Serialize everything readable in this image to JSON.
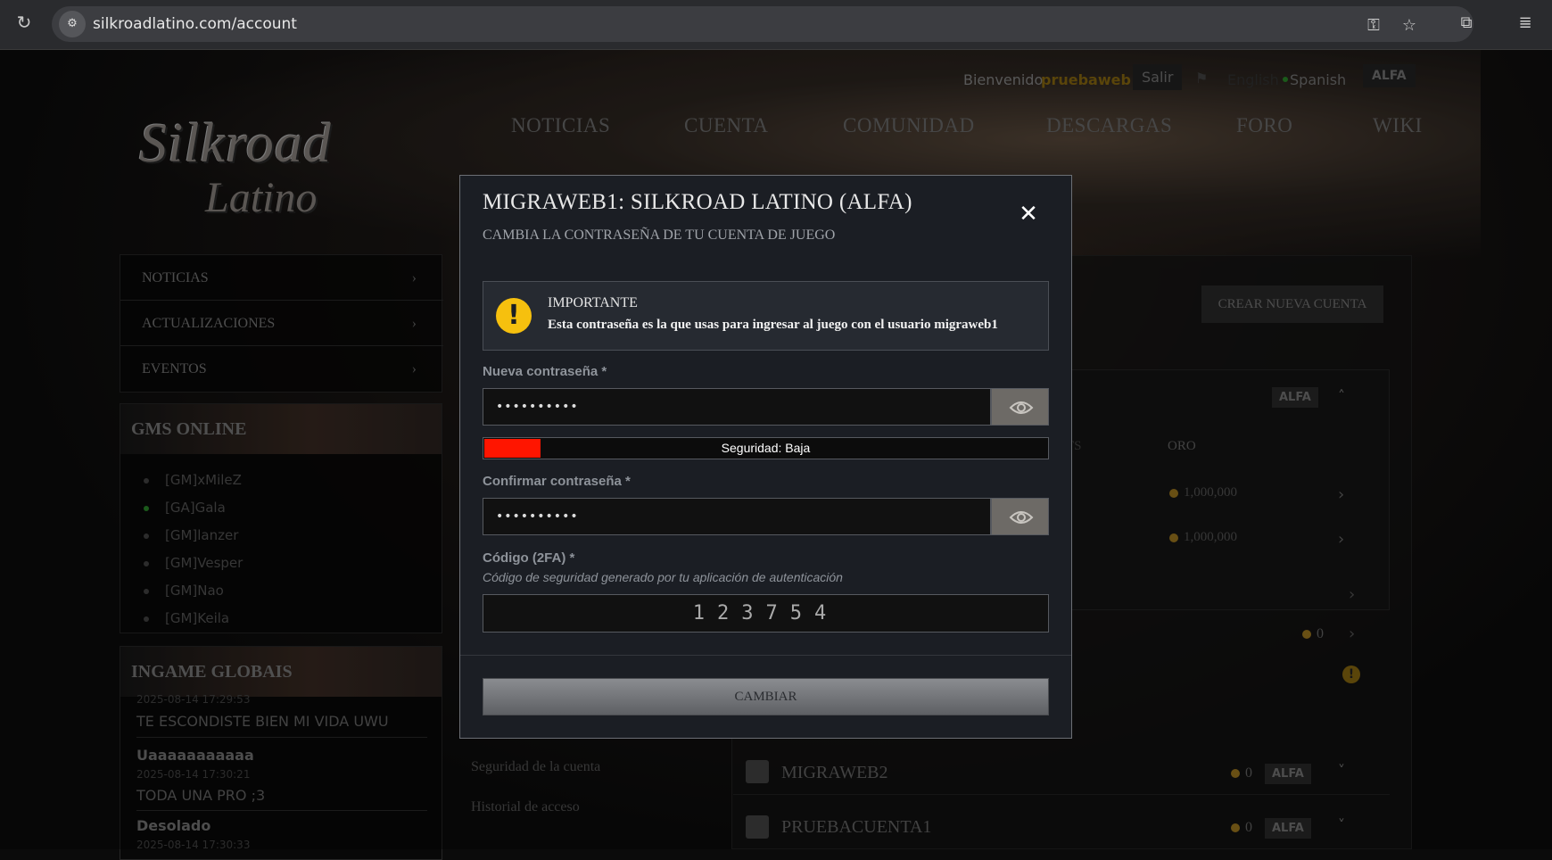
{
  "browser": {
    "url": "silkroadlatino.com/account"
  },
  "site": {
    "welcome": "Bienvenido",
    "username": "pruebaweb",
    "logout": "Salir",
    "lang_en": "English",
    "lang_es": "Spanish",
    "server_badge": "ALFA",
    "logo_line1": "Silkroad",
    "logo_line2": "Latino",
    "nav": [
      "NOTICIAS",
      "CUENTA",
      "COMUNIDAD",
      "DESCARGAS",
      "FORO",
      "WIKI"
    ]
  },
  "sidebar": {
    "items": [
      "NOTICIAS",
      "ACTUALIZACIONES",
      "EVENTOS"
    ],
    "gms_title": "GMS ONLINE",
    "gms": [
      {
        "name": "[GM]xMileZ",
        "online": false
      },
      {
        "name": "[GA]Gala",
        "online": true
      },
      {
        "name": "[GM]lanzer",
        "online": false
      },
      {
        "name": "[GM]Vesper",
        "online": false
      },
      {
        "name": "[GM]Nao",
        "online": false
      },
      {
        "name": "[GM]Keila",
        "online": false
      }
    ],
    "globals_title": "INGAME GLOBAIS",
    "globals": [
      {
        "author": "",
        "time": "2025-08-14 17:29:53",
        "msg": "TE ESCONDISTE BIEN MI VIDA UWU"
      },
      {
        "author": "Uaaaaaaaaaaa",
        "time": "2025-08-14 17:30:21",
        "msg": "TODA UNA PRO ;3"
      },
      {
        "author": "Desolado",
        "time": "2025-08-14 17:30:33",
        "msg": ""
      }
    ]
  },
  "main_bg": {
    "create_account": "CREAR NUEVA CUENTA",
    "badge": "ALFA",
    "col_ts": "TS",
    "col_oro": "ORO",
    "gold1": "1,000,000",
    "gold2": "1,000,000",
    "zero": "0",
    "links": [
      "Seguridad de la cuenta",
      "Historial de acceso"
    ],
    "accounts": [
      {
        "name": "MIGRAWEB2",
        "coins": "0",
        "badge": "ALFA"
      },
      {
        "name": "PRUEBACUENTA1",
        "coins": "0",
        "badge": "ALFA"
      }
    ]
  },
  "modal": {
    "title": "MIGRAWEB1: SILKROAD LATINO (ALFA)",
    "subtitle": "CAMBIA LA CONTRASEÑA DE TU CUENTA DE JUEGO",
    "close_icon": "close-icon",
    "notice_title": "IMPORTANTE",
    "notice_text": "Esta contraseña es la que usas para ingresar al juego con el usuario migraweb1",
    "new_password_label": "Nueva contraseña *",
    "new_password_value": "••••••••••",
    "strength_text": "Seguridad: Baja",
    "strength_level": 0.1,
    "strength_color": "#ff1500",
    "confirm_label": "Confirmar contraseña *",
    "confirm_value": "••••••••••",
    "code_label": "Código (2FA) *",
    "code_hint": "Código de seguridad generado por tu aplicación de autenticación",
    "code_value": "123754",
    "submit_label": "CAMBIAR",
    "accent": "#f6c00e"
  }
}
